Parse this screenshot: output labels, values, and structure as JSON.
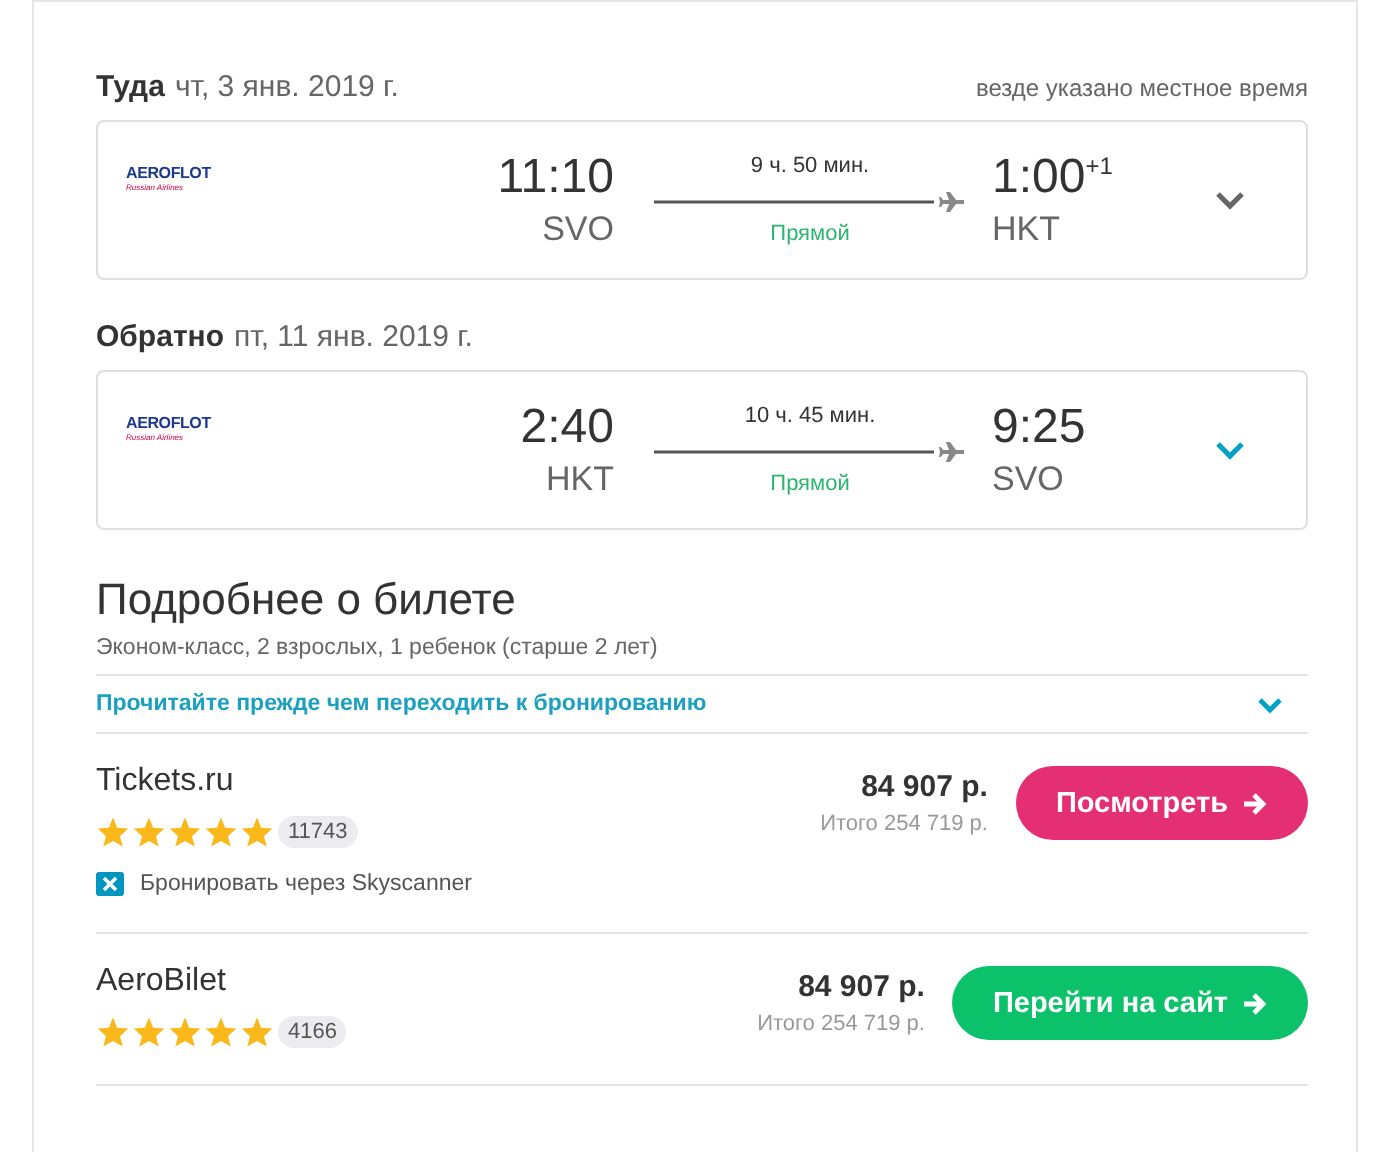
{
  "local_time_note": "везде указано местное время",
  "legs": [
    {
      "label": "Туда",
      "date": "чт, 3 янв. 2019 г.",
      "airline": {
        "logo": "AEROFLOT",
        "subtitle": "Russian Airlines"
      },
      "depart_time": "11:10",
      "depart_airport": "SVO",
      "duration": "9 ч. 50 мин.",
      "stops": "Прямой",
      "arrive_time": "1:00",
      "day_offset": "+1",
      "arrive_airport": "HKT",
      "highlighted": false
    },
    {
      "label": "Обратно",
      "date": "пт, 11 янв. 2019 г.",
      "airline": {
        "logo": "AEROFLOT",
        "subtitle": "Russian Airlines"
      },
      "depart_time": "2:40",
      "depart_airport": "HKT",
      "duration": "10 ч. 45 мин.",
      "stops": "Прямой",
      "arrive_time": "9:25",
      "arrive_airport": "SVO",
      "highlighted": true
    }
  ],
  "details": {
    "title": "Подробнее о билете",
    "subtitle": "Эконом-класс, 2 взрослых, 1 ребенок (старше 2 лет)",
    "notice": "Прочитайте прежде чем переходить к бронированию",
    "notice_expanded": false
  },
  "offers": [
    {
      "name": "Tickets.ru",
      "stars": 5,
      "reviews": "11743",
      "price": "84 907 р.",
      "total": "Итого 254 719 р.",
      "button": "Посмотреть",
      "color": "#e52f74",
      "note": "Бронировать через Skyscanner"
    },
    {
      "name": "AeroBilet",
      "stars": 5,
      "reviews": "4166",
      "price": "84 907 р.",
      "total": "Итого 254 719 р.",
      "button": "Перейти на сайт",
      "color": "#0bc26b"
    }
  ]
}
